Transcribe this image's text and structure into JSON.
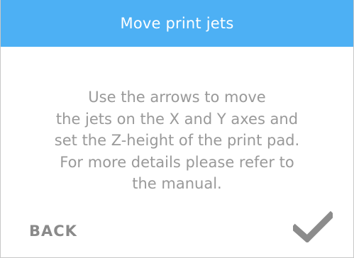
{
  "header": {
    "title": "Move print jets"
  },
  "message": {
    "lines": [
      "Use the arrows to move",
      "the jets on the X and Y axes and",
      "set the Z-height of the print pad.",
      "For more details please refer to",
      "the manual."
    ]
  },
  "footer": {
    "back_label": "BACK",
    "confirm_icon": "checkmark-icon"
  },
  "colors": {
    "header_background": "#4db0f4",
    "header_text": "#ffffff",
    "body_text": "#999999",
    "back_text": "#8a8a8a",
    "checkmark": "#8c8c8c"
  }
}
